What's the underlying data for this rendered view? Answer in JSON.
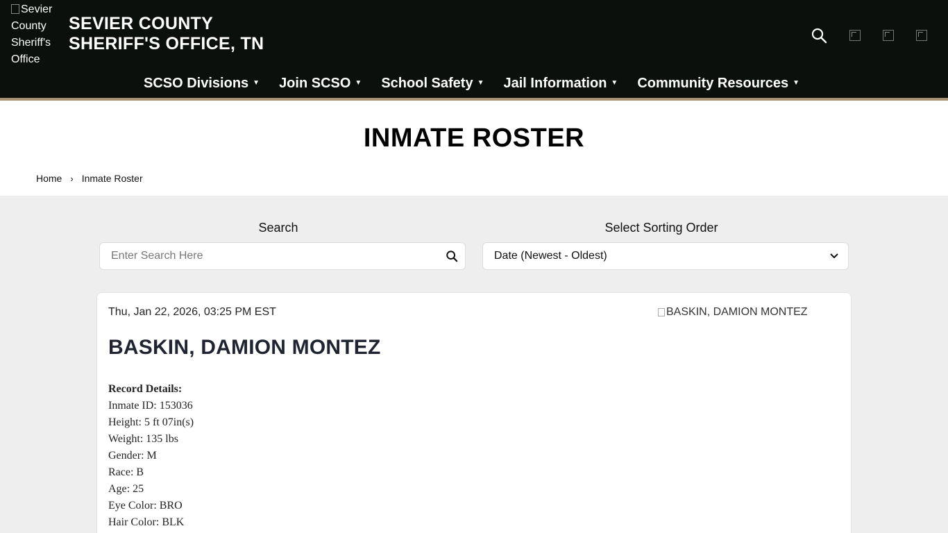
{
  "header": {
    "logo_alt": "Sevier County Sheriff's Office",
    "site_title_line1": "SEVIER COUNTY",
    "site_title_line2": "SHERIFF'S OFFICE, TN"
  },
  "nav": [
    {
      "label": "SCSO Divisions"
    },
    {
      "label": "Join SCSO"
    },
    {
      "label": "School Safety"
    },
    {
      "label": "Jail Information"
    },
    {
      "label": "Community Resources"
    }
  ],
  "page": {
    "title": "INMATE ROSTER",
    "breadcrumb": {
      "home": "Home",
      "current": "Inmate Roster"
    }
  },
  "controls": {
    "search_label": "Search",
    "search_placeholder": "Enter Search Here",
    "sort_label": "Select Sorting Order",
    "sort_value": "Date (Newest - Oldest)"
  },
  "record": {
    "date": "Thu, Jan 22, 2026, 03:25 PM EST",
    "photo_alt": "BASKIN, DAMION MONTEZ",
    "name": "BASKIN, DAMION MONTEZ",
    "details_header": "Record Details:",
    "details": [
      "Inmate ID: 153036",
      "Height: 5 ft 07in(s)",
      "Weight: 135 lbs",
      "Gender: M",
      "Race: B",
      "Age: 25",
      "Eye Color: BRO",
      "Hair Color: BLK"
    ]
  },
  "icons": [
    "search-icon",
    "social-icon-1",
    "social-icon-2",
    "social-icon-3",
    "caret-down-icon",
    "chevron-down-icon",
    "magnifier-icon"
  ]
}
